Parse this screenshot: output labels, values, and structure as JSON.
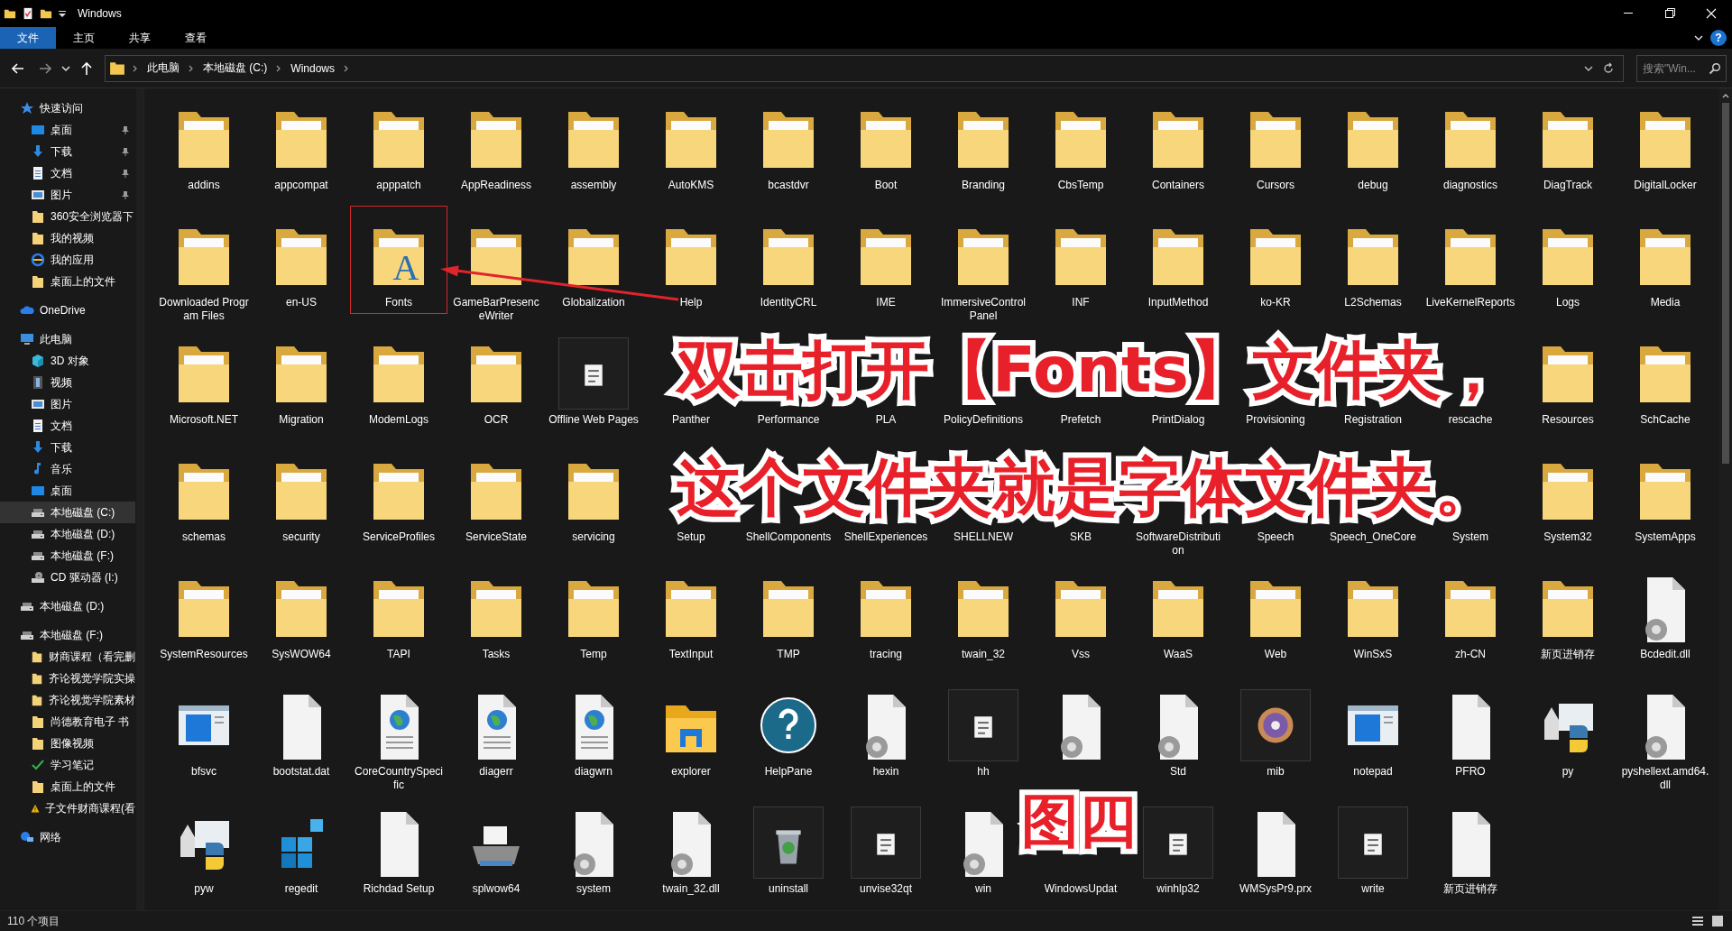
{
  "window": {
    "title": "Windows"
  },
  "ribbon": {
    "tabs": [
      {
        "label": "文件",
        "kind": "file"
      },
      {
        "label": "主页",
        "kind": "tab"
      },
      {
        "label": "共享",
        "kind": "tab"
      },
      {
        "label": "查看",
        "kind": "tab"
      }
    ],
    "help_glyph": "?"
  },
  "address_bar": {
    "breadcrumbs": [
      "此电脑",
      "本地磁盘 (C:)",
      "Windows"
    ]
  },
  "search": {
    "placeholder": "搜索\"Win..."
  },
  "sidebar": [
    {
      "label": "快速访问",
      "selected": false,
      "children": [
        {
          "label": "桌面",
          "pinned": true,
          "selected": false
        },
        {
          "label": "下载",
          "pinned": true,
          "selected": false
        },
        {
          "label": "文档",
          "pinned": true,
          "selected": false
        },
        {
          "label": "图片",
          "pinned": true,
          "selected": false
        },
        {
          "label": "360安全浏览器下",
          "pinned": false,
          "selected": false
        },
        {
          "label": "我的视频",
          "pinned": false,
          "selected": false
        },
        {
          "label": "我的应用",
          "pinned": false,
          "selected": false
        },
        {
          "label": "桌面上的文件",
          "pinned": false,
          "selected": false
        }
      ]
    },
    {
      "label": "OneDrive",
      "selected": false
    },
    {
      "label": "此电脑",
      "selected": false,
      "children": [
        {
          "label": "3D 对象",
          "selected": false
        },
        {
          "label": "视频",
          "selected": false
        },
        {
          "label": "图片",
          "selected": false
        },
        {
          "label": "文档",
          "selected": false
        },
        {
          "label": "下载",
          "selected": false
        },
        {
          "label": "音乐",
          "selected": false
        },
        {
          "label": "桌面",
          "selected": false
        },
        {
          "label": "本地磁盘 (C:)",
          "selected": true
        },
        {
          "label": "本地磁盘 (D:)",
          "selected": false
        },
        {
          "label": "本地磁盘 (F:)",
          "selected": false
        },
        {
          "label": "CD 驱动器 (I:)",
          "selected": false
        }
      ]
    },
    {
      "label": "本地磁盘 (D:)",
      "selected": false
    },
    {
      "label": "本地磁盘 (F:)",
      "selected": false,
      "children": [
        {
          "label": "财商课程（看完删",
          "selected": false
        },
        {
          "label": "齐论视觉学院实操",
          "selected": false
        },
        {
          "label": "齐论视觉学院素材",
          "selected": false
        },
        {
          "label": "尚德教育电子 书",
          "selected": false
        },
        {
          "label": "图像视频",
          "selected": false
        },
        {
          "label": "学习笔记",
          "selected": false
        },
        {
          "label": "桌面上的文件",
          "selected": false
        },
        {
          "label": "子文件财商课程(看",
          "selected": false
        }
      ]
    },
    {
      "label": "网络",
      "selected": false
    }
  ],
  "items": [
    {
      "label": "addins",
      "kind": "folder",
      "annotated": false
    },
    {
      "label": "appcompat",
      "kind": "folder",
      "annotated": false
    },
    {
      "label": "apppatch",
      "kind": "folder",
      "annotated": false
    },
    {
      "label": "AppReadiness",
      "kind": "folder",
      "annotated": false
    },
    {
      "label": "assembly",
      "kind": "folder",
      "annotated": false
    },
    {
      "label": "AutoKMS",
      "kind": "folder",
      "annotated": false
    },
    {
      "label": "bcastdvr",
      "kind": "folder",
      "annotated": false
    },
    {
      "label": "Boot",
      "kind": "folder",
      "annotated": false
    },
    {
      "label": "Branding",
      "kind": "folder",
      "annotated": false
    },
    {
      "label": "CbsTemp",
      "kind": "folder",
      "annotated": false
    },
    {
      "label": "Containers",
      "kind": "folder",
      "annotated": false
    },
    {
      "label": "Cursors",
      "kind": "folder",
      "annotated": false
    },
    {
      "label": "debug",
      "kind": "folder",
      "annotated": false
    },
    {
      "label": "diagnostics",
      "kind": "folder",
      "annotated": false
    },
    {
      "label": "DiagTrack",
      "kind": "folder",
      "annotated": false
    },
    {
      "label": "DigitalLocker",
      "kind": "folder",
      "annotated": false
    },
    {
      "label": "Downloaded Program Files",
      "kind": "folder",
      "annotated": false
    },
    {
      "label": "en-US",
      "kind": "folder",
      "annotated": false
    },
    {
      "label": "Fonts",
      "kind": "font-folder",
      "glyph": "A",
      "annotated": true
    },
    {
      "label": "GameBarPresenceWriter",
      "kind": "folder",
      "annotated": false
    },
    {
      "label": "Globalization",
      "kind": "folder",
      "annotated": false
    },
    {
      "label": "Help",
      "kind": "folder",
      "annotated": false
    },
    {
      "label": "IdentityCRL",
      "kind": "folder",
      "annotated": false
    },
    {
      "label": "IME",
      "kind": "folder",
      "annotated": false
    },
    {
      "label": "ImmersiveControlPanel",
      "kind": "folder",
      "annotated": false
    },
    {
      "label": "INF",
      "kind": "folder",
      "annotated": false
    },
    {
      "label": "InputMethod",
      "kind": "folder",
      "annotated": false
    },
    {
      "label": "ko-KR",
      "kind": "folder",
      "annotated": false
    },
    {
      "label": "L2Schemas",
      "kind": "folder",
      "annotated": false
    },
    {
      "label": "LiveKernelReports",
      "kind": "folder",
      "annotated": false
    },
    {
      "label": "Logs",
      "kind": "folder",
      "annotated": false
    },
    {
      "label": "Media",
      "kind": "folder",
      "annotated": false
    },
    {
      "label": "Microsoft.NET",
      "kind": "folder",
      "annotated": false
    },
    {
      "label": "Migration",
      "kind": "folder",
      "annotated": false
    },
    {
      "label": "ModemLogs",
      "kind": "folder",
      "annotated": false
    },
    {
      "label": "OCR",
      "kind": "folder",
      "annotated": false
    },
    {
      "label": "Offline Web Pages",
      "kind": "small-app",
      "annotated": false
    },
    {
      "label": "Panther",
      "kind": "covered",
      "annotated": false
    },
    {
      "label": "Performance",
      "kind": "covered",
      "annotated": false
    },
    {
      "label": "PLA",
      "kind": "covered",
      "annotated": false
    },
    {
      "label": "PolicyDefinitions",
      "kind": "covered",
      "annotated": false
    },
    {
      "label": "Prefetch",
      "kind": "covered",
      "annotated": false
    },
    {
      "label": "PrintDialog",
      "kind": "covered",
      "annotated": false
    },
    {
      "label": "Provisioning",
      "kind": "covered",
      "annotated": false
    },
    {
      "label": "Registration",
      "kind": "covered",
      "annotated": false
    },
    {
      "label": "rescache",
      "kind": "covered",
      "annotated": false
    },
    {
      "label": "Resources",
      "kind": "folder",
      "annotated": false
    },
    {
      "label": "SchCache",
      "kind": "folder",
      "annotated": false
    },
    {
      "label": "schemas",
      "kind": "folder",
      "annotated": false
    },
    {
      "label": "security",
      "kind": "folder",
      "annotated": false
    },
    {
      "label": "ServiceProfiles",
      "kind": "folder",
      "annotated": false
    },
    {
      "label": "ServiceState",
      "kind": "folder",
      "annotated": false
    },
    {
      "label": "servicing",
      "kind": "folder",
      "annotated": false
    },
    {
      "label": "Setup",
      "kind": "covered",
      "annotated": false
    },
    {
      "label": "ShellComponents",
      "kind": "covered",
      "annotated": false
    },
    {
      "label": "ShellExperiences",
      "kind": "covered",
      "annotated": false
    },
    {
      "label": "SHELLNEW",
      "kind": "covered",
      "annotated": false
    },
    {
      "label": "SKB",
      "kind": "covered",
      "annotated": false
    },
    {
      "label": "SoftwareDistribution",
      "kind": "covered",
      "annotated": false
    },
    {
      "label": "Speech",
      "kind": "covered",
      "annotated": false
    },
    {
      "label": "Speech_OneCore",
      "kind": "covered",
      "annotated": false
    },
    {
      "label": "System",
      "kind": "covered",
      "annotated": false
    },
    {
      "label": "System32",
      "kind": "folder",
      "annotated": false
    },
    {
      "label": "SystemApps",
      "kind": "folder",
      "annotated": false
    },
    {
      "label": "SystemResources",
      "kind": "folder",
      "annotated": false
    },
    {
      "label": "SysWOW64",
      "kind": "folder",
      "annotated": false
    },
    {
      "label": "TAPI",
      "kind": "folder",
      "annotated": false
    },
    {
      "label": "Tasks",
      "kind": "folder",
      "annotated": false
    },
    {
      "label": "Temp",
      "kind": "folder",
      "annotated": false
    },
    {
      "label": "TextInput",
      "kind": "folder",
      "annotated": false
    },
    {
      "label": "TMP",
      "kind": "folder",
      "annotated": false
    },
    {
      "label": "tracing",
      "kind": "folder",
      "annotated": false
    },
    {
      "label": "twain_32",
      "kind": "folder",
      "annotated": false
    },
    {
      "label": "Vss",
      "kind": "folder",
      "annotated": false
    },
    {
      "label": "WaaS",
      "kind": "folder",
      "annotated": false
    },
    {
      "label": "Web",
      "kind": "folder",
      "annotated": false
    },
    {
      "label": "WinSxS",
      "kind": "folder",
      "annotated": false
    },
    {
      "label": "zh-CN",
      "kind": "folder",
      "annotated": false
    },
    {
      "label": "新页进销存",
      "kind": "folder",
      "annotated": false
    },
    {
      "label": "Bcdedit.dll",
      "kind": "gear-file",
      "annotated": false
    },
    {
      "label": "bfsvc",
      "kind": "window-app",
      "annotated": false
    },
    {
      "label": "bootstat.dat",
      "kind": "file",
      "annotated": false
    },
    {
      "label": "CoreCountrySpecific",
      "kind": "web-file",
      "annotated": false
    },
    {
      "label": "diagerr",
      "kind": "web-file",
      "annotated": false
    },
    {
      "label": "diagwrn",
      "kind": "web-file",
      "annotated": false
    },
    {
      "label": "explorer",
      "kind": "folder-app",
      "annotated": false
    },
    {
      "label": "HelpPane",
      "kind": "help",
      "annotated": false
    },
    {
      "label": "hexin",
      "kind": "gear-file",
      "annotated": false
    },
    {
      "label": "hh",
      "kind": "small-app",
      "annotated": false
    },
    {
      "kind": "gear-file",
      "annotated": false
    },
    {
      "label": "Std",
      "kind": "gear-file",
      "annotated": false
    },
    {
      "label": "mib",
      "kind": "disc",
      "annotated": false
    },
    {
      "label": "notepad",
      "kind": "window-app",
      "annotated": false
    },
    {
      "label": "PFRO",
      "kind": "file",
      "annotated": false
    },
    {
      "label": "py",
      "kind": "python",
      "annotated": false
    },
    {
      "label": "pyshellext.amd64.dll",
      "kind": "gear-file",
      "annotated": false
    },
    {
      "label": "pyw",
      "kind": "python",
      "annotated": false
    },
    {
      "label": "regedit",
      "kind": "cubes",
      "annotated": false
    },
    {
      "label": "Richdad Setup",
      "kind": "file",
      "annotated": false
    },
    {
      "label": "splwow64",
      "kind": "printer",
      "annotated": false
    },
    {
      "label": "system",
      "kind": "gear-file",
      "annotated": false
    },
    {
      "label": "twain_32.dll",
      "kind": "gear-file",
      "annotated": false
    },
    {
      "label": "uninstall",
      "kind": "recycle",
      "annotated": false
    },
    {
      "label": "unvise32qt",
      "kind": "small-app",
      "annotated": false
    },
    {
      "label": "win",
      "kind": "gear-file",
      "annotated": false
    },
    {
      "label": "WindowsUpdat",
      "kind": "covered",
      "annotated": false
    },
    {
      "label": "winhlp32",
      "kind": "small-app",
      "annotated": false
    },
    {
      "label": "WMSysPr9.prx",
      "kind": "file",
      "annotated": false
    },
    {
      "label": "write",
      "kind": "small-app",
      "annotated": false
    },
    {
      "label": "新页进销存",
      "kind": "file",
      "annotated": false
    }
  ],
  "status_bar": {
    "item_count": "110 个项目"
  },
  "annotations": {
    "callout_lines": [
      "双击打开【Fonts】文件夹，",
      "这个文件夹就是字体文件夹。"
    ],
    "figure_label": "图四"
  }
}
